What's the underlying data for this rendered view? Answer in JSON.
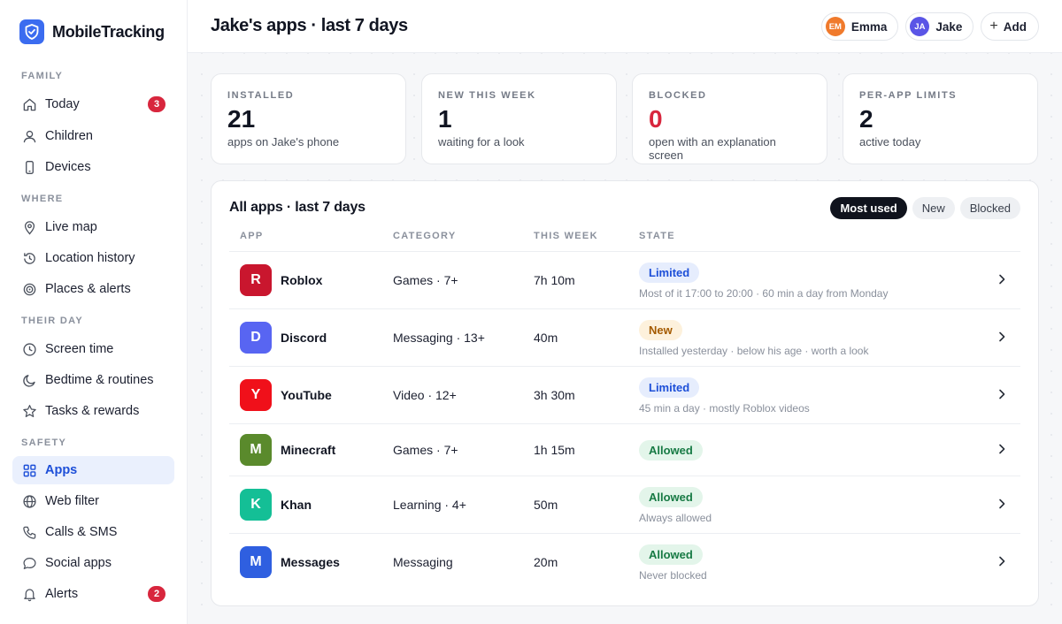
{
  "brand": {
    "name": "MobileTracking"
  },
  "sidebar": {
    "sections": [
      "FAMILY",
      "WHERE",
      "THEIR DAY",
      "SAFETY"
    ],
    "items": [
      {
        "label": "Today",
        "badge": "3",
        "icon": "home-icon"
      },
      {
        "label": "Children",
        "icon": "person-icon"
      },
      {
        "label": "Devices",
        "icon": "phone-icon"
      },
      {
        "label": "Live map",
        "icon": "pin-icon"
      },
      {
        "label": "Location history",
        "icon": "history-icon"
      },
      {
        "label": "Places & alerts",
        "icon": "target-icon"
      },
      {
        "label": "Screen time",
        "icon": "clock-icon"
      },
      {
        "label": "Bedtime & routines",
        "icon": "moon-icon"
      },
      {
        "label": "Tasks & rewards",
        "icon": "star-icon"
      },
      {
        "label": "Apps",
        "icon": "grid-icon",
        "active": true
      },
      {
        "label": "Web filter",
        "icon": "globe-icon"
      },
      {
        "label": "Calls & SMS",
        "icon": "phone-call-icon"
      },
      {
        "label": "Social apps",
        "icon": "chat-icon"
      },
      {
        "label": "Alerts",
        "badge": "2",
        "icon": "bell-icon"
      }
    ]
  },
  "header": {
    "title": "Jake's apps · last 7 days",
    "profiles": [
      {
        "initials": "EM",
        "name": "Emma",
        "color": "#f07a2c"
      },
      {
        "initials": "JA",
        "name": "Jake",
        "color": "#5a55e6"
      }
    ],
    "add_label": "Add"
  },
  "stats": [
    {
      "label": "INSTALLED",
      "value": "21",
      "sub": "apps on Jake's phone"
    },
    {
      "label": "NEW THIS WEEK",
      "value": "1",
      "sub": "waiting for a look"
    },
    {
      "label": "BLOCKED",
      "value": "0",
      "sub": "open with an explanation screen"
    },
    {
      "label": "PER-APP LIMITS",
      "value": "2",
      "sub": "active today"
    }
  ],
  "apps_panel": {
    "title": "All apps · last 7 days",
    "filters": [
      "Most used",
      "New",
      "Blocked"
    ],
    "columns": [
      "APP",
      "CATEGORY",
      "THIS WEEK",
      "STATE"
    ],
    "rows": [
      {
        "letter": "R",
        "name": "Roblox",
        "category": "Games · 7+",
        "time": "7h 10m",
        "state": "Limited",
        "note": "Most of it 17:00 to 20:00 · 60 min a day from Monday",
        "color": "#c9162e"
      },
      {
        "letter": "D",
        "name": "Discord",
        "category": "Messaging · 13+",
        "time": "40m",
        "state": "New",
        "note": "Installed yesterday · below his age · worth a look",
        "color": "#5865f2"
      },
      {
        "letter": "Y",
        "name": "YouTube",
        "category": "Video · 12+",
        "time": "3h 30m",
        "state": "Limited",
        "note": "45 min a day · mostly Roblox videos",
        "color": "#f0101a"
      },
      {
        "letter": "M",
        "name": "Minecraft",
        "category": "Games · 7+",
        "time": "1h 15m",
        "state": "Allowed",
        "note": "",
        "color": "#5a8a2c"
      },
      {
        "letter": "K",
        "name": "Khan",
        "category": "Learning · 4+",
        "time": "50m",
        "state": "Allowed",
        "note": "Always allowed",
        "color": "#14bf96"
      },
      {
        "letter": "M",
        "name": "Messages",
        "category": "Messaging",
        "time": "20m",
        "state": "Allowed",
        "note": "Never blocked",
        "color": "#2f5fe0"
      }
    ]
  }
}
